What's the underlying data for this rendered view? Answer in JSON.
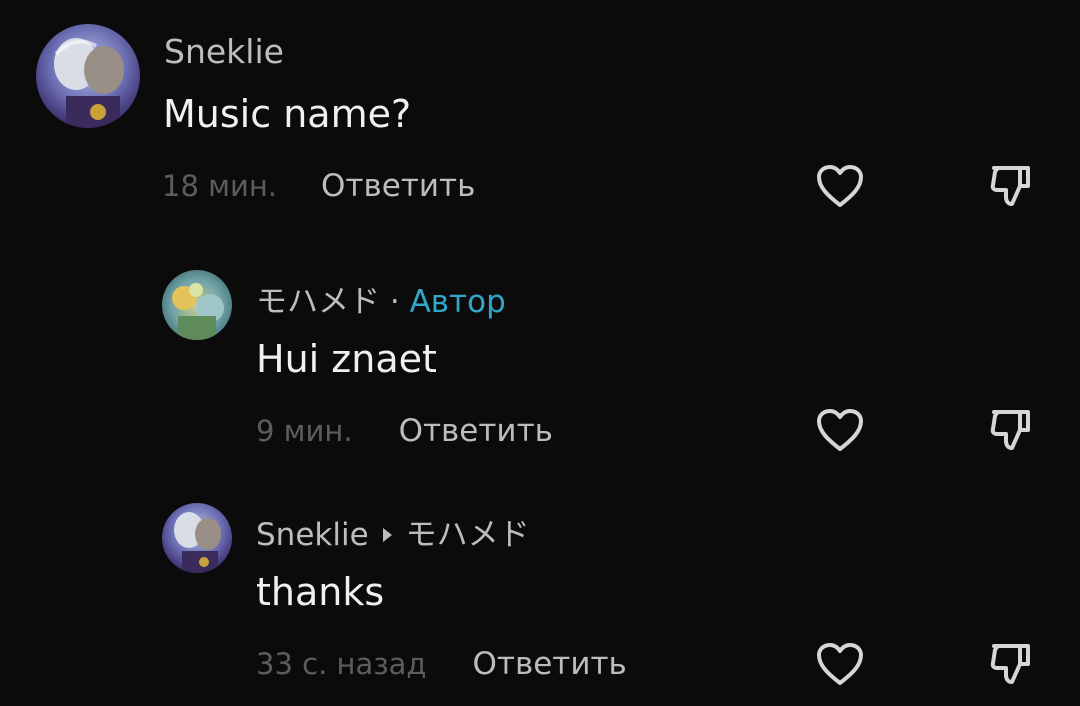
{
  "comments": [
    {
      "username": "Sneklie",
      "text": "Music name?",
      "time": "18 мин.",
      "reply_label": "Ответить"
    },
    {
      "username": "モハメド",
      "separator": "·",
      "author_badge": "Автор",
      "text": "Hui znaet",
      "time": "9 мин.",
      "reply_label": "Ответить"
    },
    {
      "username": "Sneklie",
      "reply_to": "モハメド",
      "text": "thanks",
      "time": "33 с. назад",
      "reply_label": "Ответить"
    }
  ],
  "icons": {
    "like": "heart-icon",
    "dislike": "thumbs-down-icon",
    "reply_arrow": "play-arrow-icon"
  },
  "colors": {
    "background": "#0b0b0c",
    "author_badge": "#31a7c7",
    "username": "#bdbdbd",
    "text": "#f0f0f0",
    "time": "#5c5c5c"
  }
}
